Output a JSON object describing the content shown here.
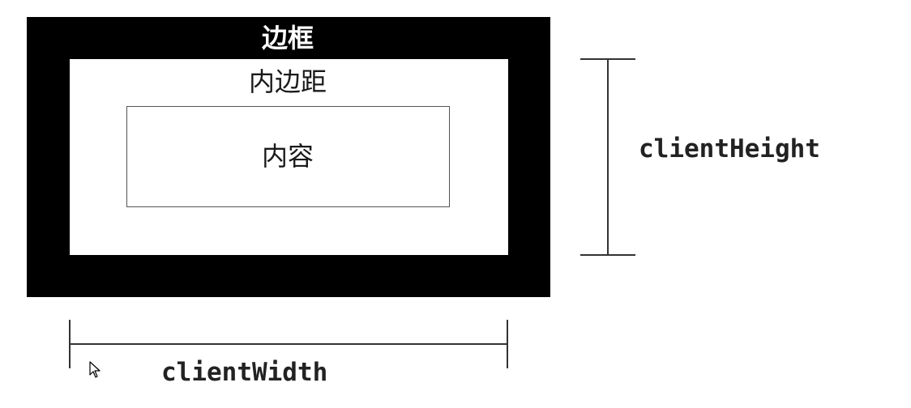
{
  "labels": {
    "border": "边框",
    "padding": "内边距",
    "content": "内容",
    "client_height": "clientHeight",
    "client_width": "clientWidth"
  },
  "icons": {
    "cursor": "mouse-pointer-icon"
  }
}
